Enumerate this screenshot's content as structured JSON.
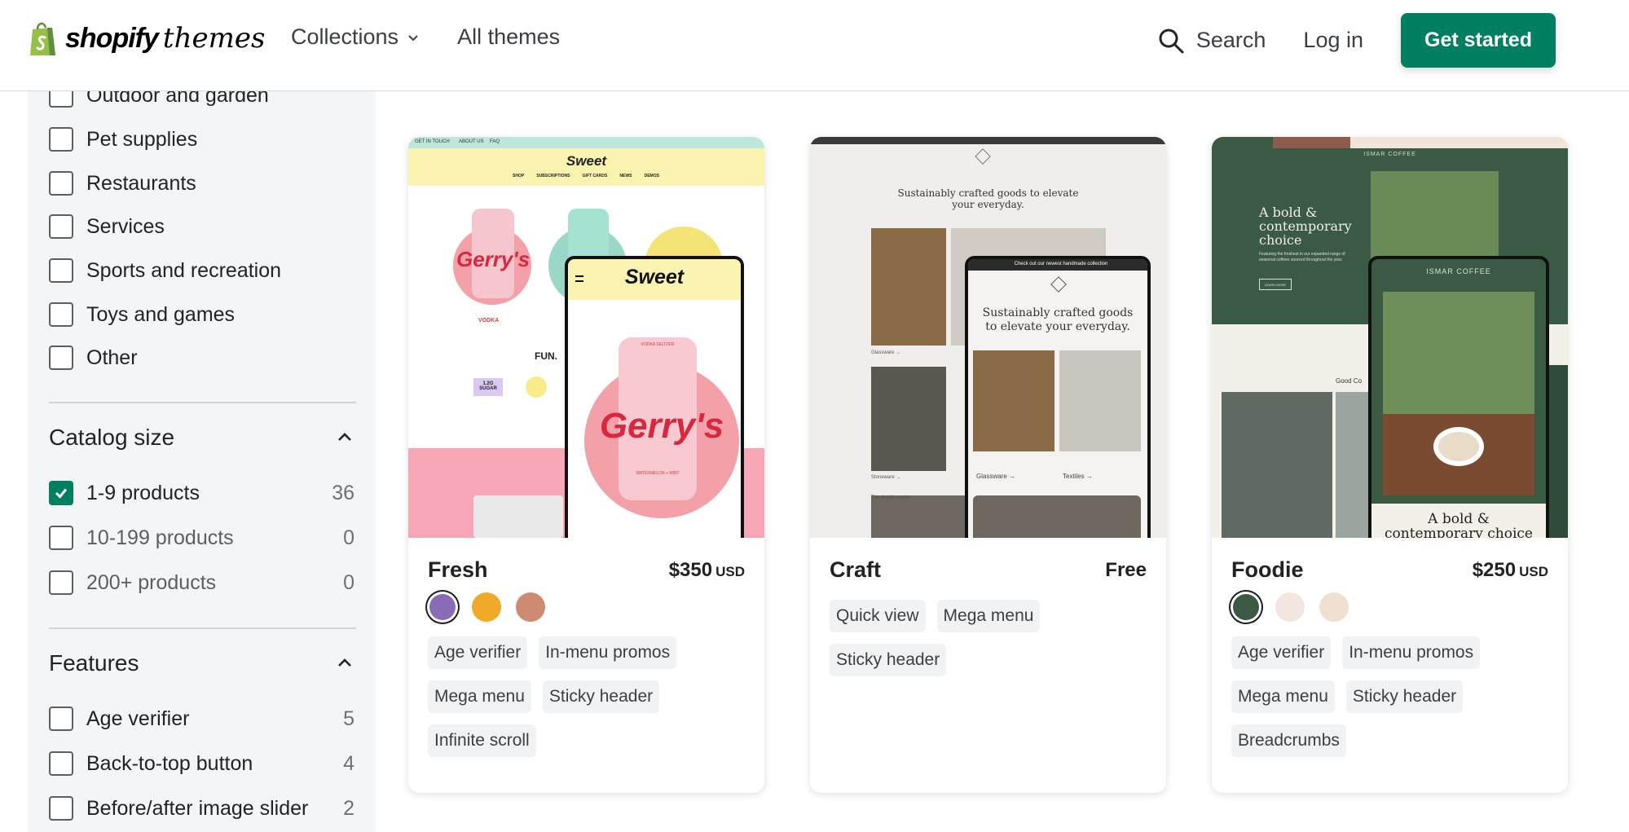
{
  "header": {
    "logo_word": "shopify",
    "logo_suffix": "themes",
    "nav": [
      {
        "label": "Collections"
      },
      {
        "label": "All themes"
      }
    ],
    "search_label": "Search",
    "login_label": "Log in",
    "cta_label": "Get started",
    "brand_color": "#008060"
  },
  "sidebar": {
    "industry_options": [
      {
        "label": "Outdoor and garden"
      },
      {
        "label": "Pet supplies"
      },
      {
        "label": "Restaurants"
      },
      {
        "label": "Services"
      },
      {
        "label": "Sports and recreation"
      },
      {
        "label": "Toys and games"
      },
      {
        "label": "Other"
      }
    ],
    "catalog": {
      "title": "Catalog size",
      "options": [
        {
          "label": "1-9 products",
          "count": "36",
          "checked": true
        },
        {
          "label": "10-199 products",
          "count": "0",
          "checked": false
        },
        {
          "label": "200+ products",
          "count": "0",
          "checked": false
        }
      ]
    },
    "features": {
      "title": "Features",
      "options": [
        {
          "label": "Age verifier",
          "count": "5"
        },
        {
          "label": "Back-to-top button",
          "count": "4"
        },
        {
          "label": "Before/after image slider",
          "count": "2"
        }
      ]
    }
  },
  "themes": [
    {
      "name": "Fresh",
      "price": "$350",
      "currency": "USD",
      "swatches": [
        "#8a6bb8",
        "#f0a928",
        "#cf8a72"
      ],
      "tags": [
        "Age verifier",
        "In-menu promos",
        "Mega menu",
        "Sticky header",
        "Infinite scroll"
      ],
      "preview": {
        "brand": "Sweet",
        "product": "Gerry's",
        "topbar_links": [
          "GET IN TOUCH",
          "ABOUT US",
          "FAQ"
        ],
        "nav": [
          "SHOP",
          "SUBSCRIPTIONS",
          "GIFT CARDS",
          "NEWS",
          "DEMOS"
        ],
        "label": "VODKA",
        "tagline": "FUN.",
        "badge": "1.2G SUGAR",
        "flavor": "WATERMELON + MINT",
        "can_top": "VODKA SELTZER"
      }
    },
    {
      "name": "Craft",
      "price": "Free",
      "currency": "",
      "swatches": [],
      "tags": [
        "Quick view",
        "Mega menu",
        "Sticky header"
      ],
      "preview": {
        "announcement": "Check out our newest handmade collection",
        "headline": "Sustainably crafted goods to elevate your everyday.",
        "labels": [
          "Glassware →",
          "Textiles →",
          "Stoneware →"
        ],
        "footer_text": "The details matter"
      }
    },
    {
      "name": "Foodie",
      "price": "$250",
      "currency": "USD",
      "swatches": [
        "#3a5a44",
        "#f3e6df",
        "#efe0d2"
      ],
      "tags": [
        "Age verifier",
        "In-menu promos",
        "Mega menu",
        "Sticky header",
        "Breadcrumbs"
      ],
      "preview": {
        "brand": "ISMAR COFFEE",
        "headline": "A bold & contemporary choice",
        "body": "Featuring the freshest in our expanded range of seasonal coffees sourced throughout the year.",
        "button": "LEARN MORE",
        "good": "Good Co",
        "phone_headline": "A bold & contemporary choice"
      }
    }
  ]
}
